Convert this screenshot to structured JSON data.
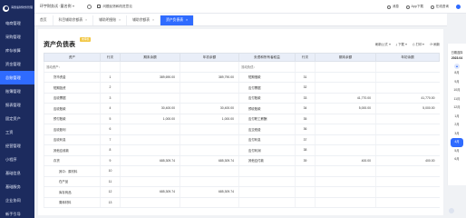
{
  "sidebar": {
    "logo_text": "海鼎速财财务管理",
    "items": [
      {
        "label": "电商管理",
        "active": false
      },
      {
        "label": "采购管理",
        "active": false
      },
      {
        "label": "库存核算",
        "active": false
      },
      {
        "label": "资金管理",
        "active": false
      },
      {
        "label": "总账管理",
        "active": true
      },
      {
        "label": "账簿管理",
        "active": false
      },
      {
        "label": "报表管理",
        "active": false
      },
      {
        "label": "固定资产",
        "active": false
      },
      {
        "label": "工资",
        "active": false
      },
      {
        "label": "经营管理",
        "active": false
      },
      {
        "label": "小程序",
        "active": false
      },
      {
        "label": "基础信息",
        "active": false
      },
      {
        "label": "基础服务",
        "active": false
      },
      {
        "label": "企业协同",
        "active": false
      },
      {
        "label": "新手引导",
        "active": false
      }
    ]
  },
  "topbar": {
    "company": "环宇财务试 ·量名例",
    "feedback": "问题反馈和改进意见",
    "right_items": [
      "消息",
      "App下载",
      "在线咨询"
    ]
  },
  "tabs": [
    {
      "label": "首页",
      "active": false,
      "closable": false
    },
    {
      "label": "科目辅助余额表",
      "active": false,
      "closable": true
    },
    {
      "label": "辅助明细账",
      "active": false,
      "closable": true
    },
    {
      "label": "辅助余额表",
      "active": false,
      "closable": true
    },
    {
      "label": "资产负债表",
      "active": true,
      "closable": true
    }
  ],
  "page": {
    "title": "资产负债表",
    "status_pill": "未审核",
    "tools": [
      "刷新公式",
      "下载",
      "打印",
      "刷新"
    ]
  },
  "table": {
    "headers": [
      "资产",
      "行次",
      "期末余额",
      "年初余额",
      "负债和所有者权益",
      "行次",
      "期末余额",
      "年初余额"
    ],
    "rows": [
      {
        "a_name": "流动资产：",
        "a_no": "",
        "a_end": "",
        "a_begin": "",
        "l_name": "流动负债：",
        "l_no": "",
        "l_end": "",
        "l_begin": "",
        "a_type": "head"
      },
      {
        "a_name": "货币资金",
        "a_no": "1",
        "a_end": "389,690.00",
        "a_begin": "389,790.00",
        "l_name": "短期借款",
        "l_no": "31",
        "l_end": "",
        "l_begin": "",
        "a_type": "item"
      },
      {
        "a_name": "短期投资",
        "a_no": "2",
        "a_end": "",
        "a_begin": "",
        "l_name": "应付票据",
        "l_no": "32",
        "l_end": "",
        "l_begin": "",
        "a_type": "item"
      },
      {
        "a_name": "应收票据",
        "a_no": "3",
        "a_end": "",
        "a_begin": "",
        "l_name": "应付账款",
        "l_no": "33",
        "l_end": "41,770.00",
        "l_begin": "41,770.00",
        "a_type": "item"
      },
      {
        "a_name": "应收账款",
        "a_no": "4",
        "a_end": "30,400.00",
        "a_begin": "30,400.00",
        "l_name": "预收账款",
        "l_no": "34",
        "l_end": "5,000.00",
        "l_begin": "5,000.00",
        "a_type": "item"
      },
      {
        "a_name": "预付账款",
        "a_no": "5",
        "a_end": "1,000.00",
        "a_begin": "1,000.00",
        "l_name": "应付职工薪酬",
        "l_no": "35",
        "l_end": "",
        "l_begin": "",
        "a_type": "item"
      },
      {
        "a_name": "应收股利",
        "a_no": "6",
        "a_end": "",
        "a_begin": "",
        "l_name": "应交税费",
        "l_no": "36",
        "l_end": "",
        "l_begin": "",
        "a_type": "item"
      },
      {
        "a_name": "应收利息",
        "a_no": "7",
        "a_end": "",
        "a_begin": "",
        "l_name": "应付利息",
        "l_no": "37",
        "l_end": "",
        "l_begin": "",
        "a_type": "item"
      },
      {
        "a_name": "其他应收款",
        "a_no": "8",
        "a_end": "",
        "a_begin": "",
        "l_name": "应付利润",
        "l_no": "38",
        "l_end": "",
        "l_begin": "",
        "a_type": "item"
      },
      {
        "a_name": "存货",
        "a_no": "9",
        "a_end": "685,309.74",
        "a_begin": "685,309.74",
        "l_name": "其他应付款",
        "l_no": "39",
        "l_end": "400.00",
        "l_begin": "400.00",
        "a_type": "item"
      },
      {
        "a_name": "其中：原材料",
        "a_no": "10",
        "a_end": "",
        "a_begin": "",
        "l_name": "",
        "l_no": "",
        "l_end": "",
        "l_begin": "",
        "a_type": "sub"
      },
      {
        "a_name": "在产品",
        "a_no": "11",
        "a_end": "",
        "a_begin": "",
        "l_name": "",
        "l_no": "",
        "l_end": "",
        "l_begin": "",
        "a_type": "sub"
      },
      {
        "a_name": "库存商品",
        "a_no": "12",
        "a_end": "685,309.74",
        "a_begin": "685,309.74",
        "l_name": "",
        "l_no": "",
        "l_end": "",
        "l_begin": "",
        "a_type": "sub"
      },
      {
        "a_name": "周转材料",
        "a_no": "13",
        "a_end": "",
        "a_begin": "",
        "l_name": "",
        "l_no": "",
        "l_end": "",
        "l_begin": "",
        "a_type": "sub"
      }
    ]
  },
  "calendar": {
    "header": "日期选择",
    "year_month": "2023.04",
    "months": [
      {
        "label": "8月",
        "active": false
      },
      {
        "label": "9月",
        "active": false
      },
      {
        "label": "10月",
        "active": false
      },
      {
        "label": "11月",
        "active": false
      },
      {
        "label": "12月",
        "active": false
      },
      {
        "label": "1月",
        "active": false
      },
      {
        "label": "2月",
        "active": false
      },
      {
        "label": "3月",
        "active": false
      },
      {
        "label": "4月",
        "active": true
      },
      {
        "label": "5月",
        "active": false
      },
      {
        "label": "6月",
        "active": false
      }
    ]
  },
  "colors": {
    "sidebar_bg": "#1c2b5e",
    "accent": "#2f6bff",
    "pill": "#f2c744"
  },
  "icons": [
    "logo-icon",
    "caret-down-icon",
    "gear-icon",
    "feedback-icon",
    "bell-icon",
    "phone-icon",
    "chat-icon",
    "avatar",
    "refresh-icon",
    "download-icon",
    "print-icon",
    "calendar-icon",
    "scroll-top-icon"
  ]
}
